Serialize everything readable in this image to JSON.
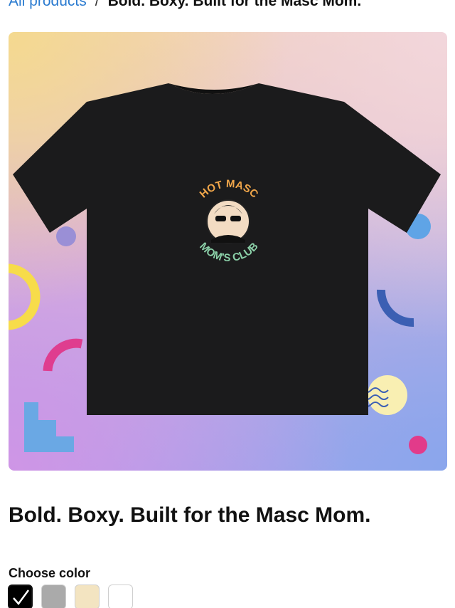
{
  "breadcrumb": {
    "parent_label": "All products",
    "separator": "/",
    "current_label": "Bold. Boxy. Built for the Masc Mom."
  },
  "product": {
    "title": "Bold. Boxy. Built for the Masc Mom.",
    "graphic": {
      "top_text": "HOT MASC",
      "bottom_text": "MOM'S CLUB"
    }
  },
  "gallery": {
    "image_count": 2,
    "active_index": 0
  },
  "color_picker": {
    "label": "Choose color",
    "selected": "Black",
    "swatches": [
      {
        "color": "#000000",
        "selected": true
      },
      {
        "color": "#aaaaaa",
        "selected": false
      },
      {
        "color": "#f3e4c1",
        "selected": false
      },
      {
        "color": "#ffffff",
        "selected": false
      }
    ]
  },
  "colors": {
    "link": "#2b7bd0",
    "shirt": "#1b1b1c",
    "text": "#111111"
  }
}
